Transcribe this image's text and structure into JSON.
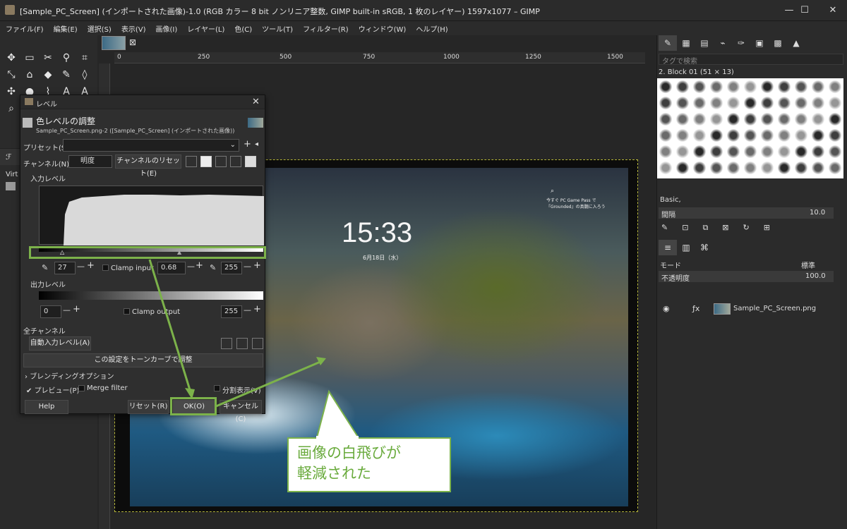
{
  "window": {
    "title": "[Sample_PC_Screen] (インポートされた画像)-1.0 (RGB カラー 8 bit ノンリニア整数, GIMP built-in sRGB, 1 枚のレイヤー) 1597x1077 – GIMP",
    "controls": [
      "—",
      "☐",
      "✕"
    ]
  },
  "menu": [
    "ファイル(F)",
    "編集(E)",
    "選択(S)",
    "表示(V)",
    "画像(I)",
    "レイヤー(L)",
    "色(C)",
    "ツール(T)",
    "フィルター(R)",
    "ウィンドウ(W)",
    "ヘルプ(H)"
  ],
  "ruler_ticks": [
    "0",
    "250",
    "500",
    "750",
    "1000",
    "1250",
    "1500"
  ],
  "left_panel": {
    "virt_label": "Virt"
  },
  "image_screen": {
    "time": "15:33",
    "date": "6月18日（水）",
    "notice": "今すぐ PC Game Pass で『Grounded』の真髄に入ろう"
  },
  "right_panel": {
    "tag_placeholder": "タグで検索",
    "brush_name": "2. Block 01 (51 × 13)",
    "preset_basic": "Basic,",
    "spacing_label": "間隔",
    "spacing_value": "10.0",
    "mode_label": "モード",
    "mode_value": "標準",
    "opacity_label": "不透明度",
    "opacity_value": "100.0",
    "layer_name": "Sample_PC_Screen.png"
  },
  "dialog": {
    "title": "レベル",
    "heading": "色レベルの調整",
    "subheading": "Sample_PC_Screen.png-2 ([Sample_PC_Screen] (インポートされた画像))",
    "preset_label": "プリセット(S):",
    "channel_label": "チャンネル(N):",
    "channel_value": "明度",
    "reset_channel": "チャンネルのリセット(E)",
    "input_levels": "入力レベル",
    "input_low": "27",
    "gamma": "0.68",
    "input_high": "255",
    "clamp_input": "Clamp input",
    "output_levels": "出力レベル",
    "output_low": "0",
    "output_high": "255",
    "clamp_output": "Clamp output",
    "all_channels": "全チャンネル",
    "auto_input": "自動入力レベル(A)",
    "to_curves": "この設定をトーンカーブで調整",
    "blending": "ブレンディングオプション",
    "preview": "プレビュー(P)",
    "merge_filter": "Merge filter",
    "split_view": "分割表示(V)",
    "help": "Help",
    "reset": "リセット(R)",
    "ok": "OK(O)",
    "cancel": "キャンセル(C)"
  },
  "callout": {
    "line1": "画像の白飛びが",
    "line2": "軽減された"
  },
  "colors": {
    "accent_green": "#7cb24a",
    "panel": "#2b2b2b",
    "dialog": "#2f2f2f"
  }
}
